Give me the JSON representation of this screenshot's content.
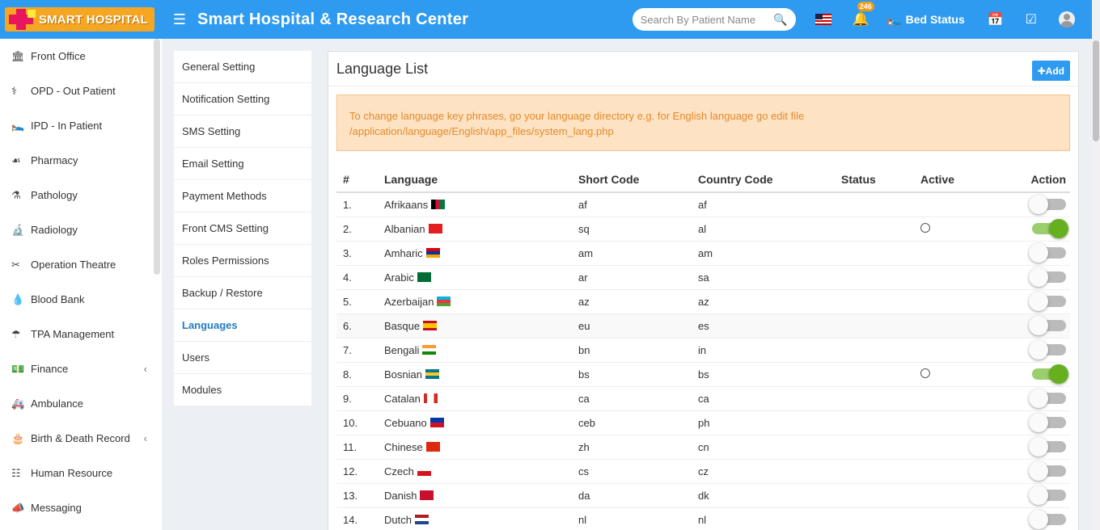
{
  "header": {
    "logo_text": "SMART HOSPITAL",
    "app_title": "Smart Hospital & Research Center",
    "search_placeholder": "Search By Patient Name",
    "notification_count": "246",
    "bed_status_label": "Bed Status"
  },
  "sidebar": {
    "items": [
      {
        "label": "Front Office",
        "icon": "building-icon"
      },
      {
        "label": "OPD - Out Patient",
        "icon": "stethoscope-icon"
      },
      {
        "label": "IPD - In Patient",
        "icon": "bed-icon"
      },
      {
        "label": "Pharmacy",
        "icon": "mortar-pestle-icon"
      },
      {
        "label": "Pathology",
        "icon": "flask-icon"
      },
      {
        "label": "Radiology",
        "icon": "microscope-icon"
      },
      {
        "label": "Operation Theatre",
        "icon": "scissors-icon"
      },
      {
        "label": "Blood Bank",
        "icon": "blood-drop-icon"
      },
      {
        "label": "TPA Management",
        "icon": "umbrella-icon"
      },
      {
        "label": "Finance",
        "icon": "money-icon",
        "has_chevron": true
      },
      {
        "label": "Ambulance",
        "icon": "ambulance-icon"
      },
      {
        "label": "Birth & Death Record",
        "icon": "birthday-cake-icon",
        "has_chevron": true
      },
      {
        "label": "Human Resource",
        "icon": "sitemap-icon"
      },
      {
        "label": "Messaging",
        "icon": "bullhorn-icon"
      }
    ]
  },
  "settings_menu": {
    "items": [
      "General Setting",
      "Notification Setting",
      "SMS Setting",
      "Email Setting",
      "Payment Methods",
      "Front CMS Setting",
      "Roles Permissions",
      "Backup / Restore",
      "Languages",
      "Users",
      "Modules"
    ],
    "active": "Languages"
  },
  "panel": {
    "title": "Language List",
    "add_label": "Add",
    "alert_line1": "To change language key phrases, go your language directory e.g. for English language go edit file",
    "alert_line2": "/application/language/English/app_files/system_lang.php",
    "columns": [
      "#",
      "Language",
      "Short Code",
      "Country Code",
      "Status",
      "Active",
      "Action"
    ],
    "rows": [
      {
        "num": "1.",
        "language": "Afrikaans",
        "short": "af",
        "country": "af",
        "active_radio": false,
        "enabled": false,
        "flag": "af"
      },
      {
        "num": "2.",
        "language": "Albanian",
        "short": "sq",
        "country": "al",
        "active_radio": true,
        "enabled": true,
        "flag": "al"
      },
      {
        "num": "3.",
        "language": "Amharic",
        "short": "am",
        "country": "am",
        "active_radio": false,
        "enabled": false,
        "flag": "am"
      },
      {
        "num": "4.",
        "language": "Arabic",
        "short": "ar",
        "country": "sa",
        "active_radio": false,
        "enabled": false,
        "flag": "sa"
      },
      {
        "num": "5.",
        "language": "Azerbaijan",
        "short": "az",
        "country": "az",
        "active_radio": false,
        "enabled": false,
        "flag": "az"
      },
      {
        "num": "6.",
        "language": "Basque",
        "short": "eu",
        "country": "es",
        "active_radio": false,
        "enabled": false,
        "flag": "es"
      },
      {
        "num": "7.",
        "language": "Bengali",
        "short": "bn",
        "country": "in",
        "active_radio": false,
        "enabled": false,
        "flag": "in"
      },
      {
        "num": "8.",
        "language": "Bosnian",
        "short": "bs",
        "country": "bs",
        "active_radio": true,
        "enabled": true,
        "flag": "bs"
      },
      {
        "num": "9.",
        "language": "Catalan",
        "short": "ca",
        "country": "ca",
        "active_radio": false,
        "enabled": false,
        "flag": "ca"
      },
      {
        "num": "10.",
        "language": "Cebuano",
        "short": "ceb",
        "country": "ph",
        "active_radio": false,
        "enabled": false,
        "flag": "ph"
      },
      {
        "num": "11.",
        "language": "Chinese",
        "short": "zh",
        "country": "cn",
        "active_radio": false,
        "enabled": false,
        "flag": "cn"
      },
      {
        "num": "12.",
        "language": "Czech",
        "short": "cs",
        "country": "cz",
        "active_radio": false,
        "enabled": false,
        "flag": "cz"
      },
      {
        "num": "13.",
        "language": "Danish",
        "short": "da",
        "country": "dk",
        "active_radio": false,
        "enabled": false,
        "flag": "dk"
      },
      {
        "num": "14.",
        "language": "Dutch",
        "short": "nl",
        "country": "nl",
        "active_radio": false,
        "enabled": false,
        "flag": "nl"
      }
    ]
  },
  "colors": {
    "header_blue": "#2f9bf0",
    "toggle_on": "#66b01f",
    "alert_bg": "#fde3c3",
    "alert_text": "#e6892b",
    "active_menu": "#1f7cc4"
  }
}
